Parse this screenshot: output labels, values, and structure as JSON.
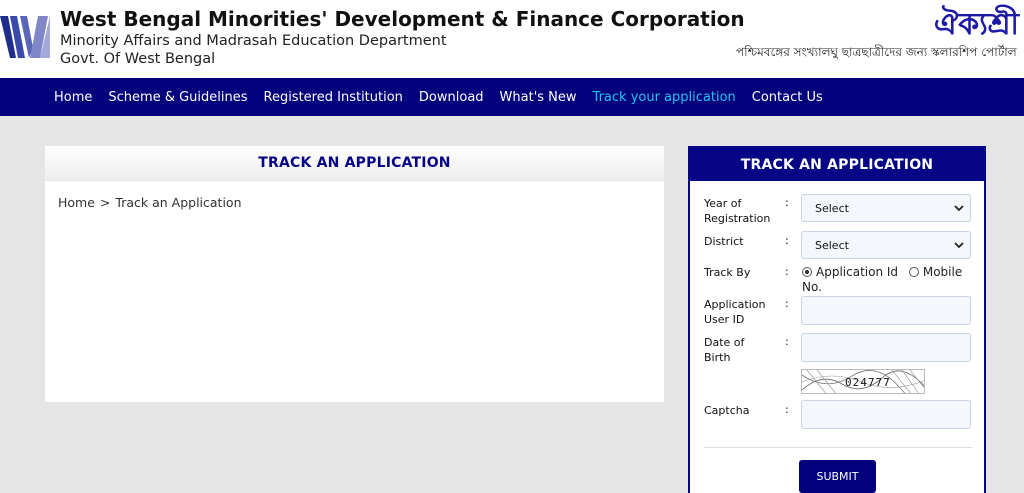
{
  "header": {
    "org_title": "West Bengal Minorities' Development & Finance Corporation",
    "org_subtitle": "Minority Affairs and Madrasah Education Department",
    "org_subtitle2": "Govt. Of West Bengal",
    "brand_bn": "ঐক্যশ্রী",
    "tagline_bn": "পশ্চিমবঙ্গের সংখ্যালঘু ছাত্রছাত্রীদের জন্য স্কলারশিপ পোর্টাল"
  },
  "nav": {
    "items": [
      "Home",
      "Scheme & Guidelines",
      "Registered Institution",
      "Download",
      "What's New",
      "Track your application",
      "Contact Us"
    ],
    "active_index": 5
  },
  "main": {
    "title": "TRACK AN APPLICATION",
    "breadcrumb": {
      "home": "Home",
      "separator": ">",
      "current": "Track an Application"
    }
  },
  "form": {
    "title": "TRACK AN APPLICATION",
    "year_label": "Year of Registration",
    "year_value": "Select",
    "district_label": "District",
    "district_value": "Select",
    "trackby_label": "Track By",
    "trackby_option1": "Application Id",
    "trackby_option2": "Mobile No.",
    "trackby_selected": "Application Id",
    "appid_label": "Application User ID",
    "dob_label": "Date of Birth",
    "captcha_text": "024777",
    "captcha_label": "Captcha",
    "submit_label": "SUBMIT",
    "colon": ":"
  },
  "colors": {
    "nav_bg": "#03027c",
    "nav_active": "#22c4f0",
    "heading": "#050585"
  }
}
